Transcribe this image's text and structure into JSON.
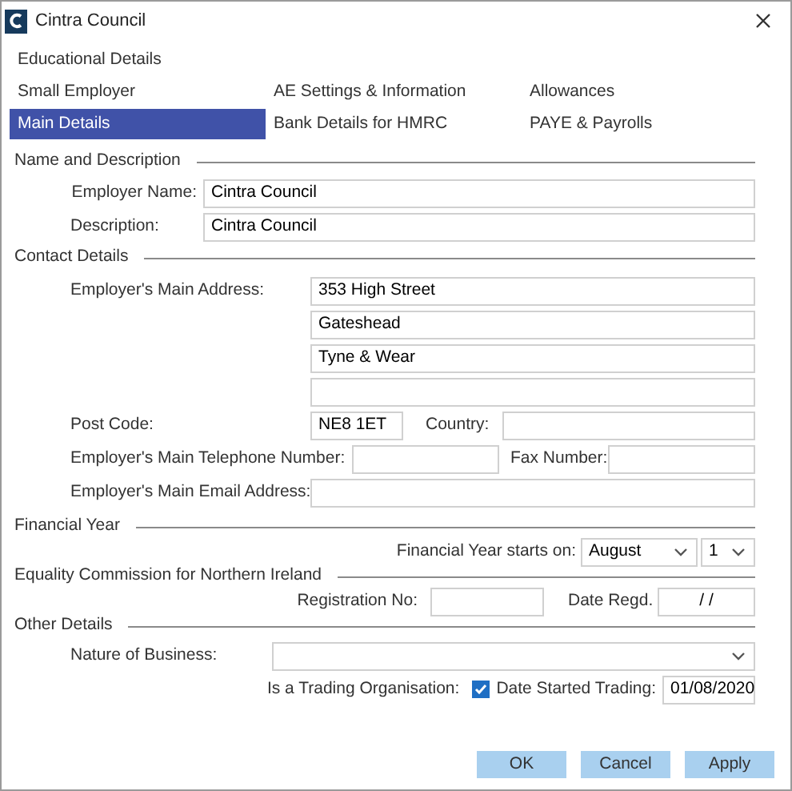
{
  "window": {
    "title": "Cintra Council"
  },
  "tab_rows": [
    [
      {
        "label": "Educational Details",
        "selected": false
      }
    ],
    [
      {
        "label": "Small Employer",
        "selected": false
      },
      {
        "label": "AE Settings & Information",
        "selected": false
      },
      {
        "label": "Allowances",
        "selected": false
      }
    ],
    [
      {
        "label": "Main Details",
        "selected": true
      },
      {
        "label": "Bank Details for HMRC",
        "selected": false
      },
      {
        "label": "PAYE & Payrolls",
        "selected": false
      }
    ]
  ],
  "name_and_description": {
    "title": "Name and Description",
    "employer_name": {
      "label": "Employer Name:",
      "value": "Cintra Council"
    },
    "description": {
      "label": "Description:",
      "value": "Cintra Council"
    }
  },
  "contact_details": {
    "title": "Contact Details",
    "address": {
      "label": "Employer's Main Address:",
      "lines": [
        {
          "value": "353 High Street"
        },
        {
          "value": "Gateshead"
        },
        {
          "value": "Tyne & Wear"
        }
      ]
    },
    "post_code": {
      "label": "Post Code:",
      "value": "NE8 1ET"
    },
    "country": {
      "label": "Country:"
    },
    "telephone": {
      "label": "Employer's Main Telephone Number:"
    },
    "fax": {
      "label": "Fax Number:"
    },
    "email": {
      "label": "Employer's Main Email Address:"
    }
  },
  "financial_year": {
    "title": "Financial Year",
    "starts_on": {
      "label": "Financial Year starts on:",
      "month": "August",
      "day": "1"
    }
  },
  "equality_commission": {
    "title": "Equality Commission for Northern Ireland",
    "registration_no": {
      "label": "Registration No:"
    },
    "date_regd": {
      "label": "Date Regd.",
      "value": "/ /"
    }
  },
  "other_details": {
    "title": "Other Details",
    "nature_of_business": {
      "label": "Nature of Business:"
    },
    "trading": {
      "label": "Is a Trading Organisation:",
      "checked": true
    },
    "date_started": {
      "label": "Date Started Trading:",
      "value": "01/08/2020"
    }
  },
  "buttons": [
    {
      "label": "OK"
    },
    {
      "label": "Cancel"
    },
    {
      "label": "Apply"
    }
  ]
}
